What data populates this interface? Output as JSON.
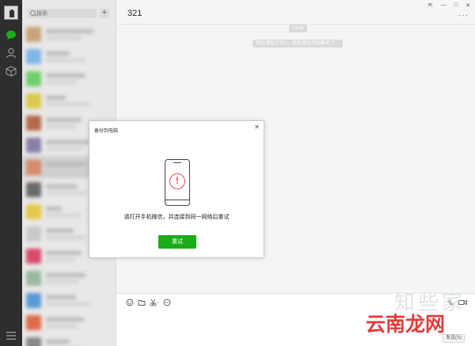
{
  "sidebar": {
    "search_placeholder": "搜索",
    "add_label": "+"
  },
  "chat": {
    "title": "321",
    "more_label": "···",
    "time_chip": "13:48",
    "system_message": "你已添加了321，现在可以开始聊天了。",
    "send_label": "发送(S)"
  },
  "window": {
    "pin": "⇱",
    "minimize": "—",
    "maximize": "□",
    "close": "✕"
  },
  "dialog": {
    "title": "备份到电脑",
    "close_label": "✕",
    "alert_glyph": "!",
    "message": "请打开手机微信，并连接到同一网络后重试",
    "retry_label": "重试"
  },
  "watermark": {
    "top": "知些家",
    "bottom": "云南龙网"
  },
  "colors": {
    "accent": "#1aad19",
    "rail": "#2e2e2e",
    "alert": "#e05050",
    "watermark_red": "#e23b3b"
  }
}
